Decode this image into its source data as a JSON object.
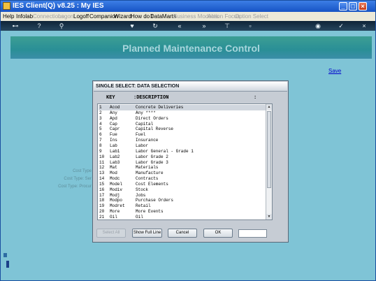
{
  "window": {
    "title": "IES Client(Q) v8.25 : My IES"
  },
  "menu": {
    "items": [
      {
        "label": "Help",
        "enabled": true
      },
      {
        "label": "Infolab",
        "enabled": true
      },
      {
        "label": "Connections",
        "enabled": false
      },
      {
        "label": "Logon",
        "enabled": false
      },
      {
        "label": "Logoff",
        "enabled": true
      },
      {
        "label": "Companion",
        "enabled": true
      },
      {
        "label": "Wizard",
        "enabled": true
      },
      {
        "label": "How do I",
        "enabled": true
      },
      {
        "label": "DataMarts",
        "enabled": true
      },
      {
        "label": "Business Modules",
        "enabled": false
      },
      {
        "label": "Action Focus",
        "enabled": false
      },
      {
        "label": "Option Select",
        "enabled": false
      }
    ]
  },
  "toolbar": {
    "icons": [
      "key-icon",
      "help-icon",
      "search-icon",
      "heart-icon",
      "refresh-icon",
      "rewind-icon",
      "forward-icon",
      "filter-icon",
      "stop-icon",
      "globe-icon",
      "check-icon",
      "close-icon"
    ]
  },
  "page": {
    "title": "Planned Maintenance Control",
    "save_link": "Save",
    "bg_labels": [
      "Cost Type",
      "Cost Type: Ser",
      "Cost Type: Procur"
    ]
  },
  "dialog": {
    "title": "SINGLE SELECT: DATA SELECTION",
    "header": {
      "key": "KEY",
      "description": ":DESCRIPTION",
      "tail": ":"
    },
    "rows": [
      {
        "num": "1",
        "key": "Acod",
        "desc": "Concrete Deliveries"
      },
      {
        "num": "2",
        "key": "Any",
        "desc": "Any ****"
      },
      {
        "num": "3",
        "key": "Apd",
        "desc": "Direct Orders"
      },
      {
        "num": "4",
        "key": "Cap",
        "desc": "Capital"
      },
      {
        "num": "5",
        "key": "Capr",
        "desc": "Capital Reverse"
      },
      {
        "num": "6",
        "key": "Fue",
        "desc": "Fuel"
      },
      {
        "num": "7",
        "key": "Ins",
        "desc": "Insurance"
      },
      {
        "num": "8",
        "key": "Lab",
        "desc": "Labor"
      },
      {
        "num": "9",
        "key": "Lab1",
        "desc": "Labor General - Grade 1"
      },
      {
        "num": "10",
        "key": "Lab2",
        "desc": "Labor Grade 2"
      },
      {
        "num": "11",
        "key": "Lab3",
        "desc": "Labor Grade 3"
      },
      {
        "num": "12",
        "key": "Mat",
        "desc": "Materials"
      },
      {
        "num": "13",
        "key": "Mod",
        "desc": "Manufacture"
      },
      {
        "num": "14",
        "key": "Modc",
        "desc": "Contracts"
      },
      {
        "num": "15",
        "key": "Model",
        "desc": "Cost Elements"
      },
      {
        "num": "16",
        "key": "Modiv",
        "desc": "Stock"
      },
      {
        "num": "17",
        "key": "Modj",
        "desc": "Jobs"
      },
      {
        "num": "18",
        "key": "Modpo",
        "desc": "Purchase Orders"
      },
      {
        "num": "19",
        "key": "Modret",
        "desc": "Retail"
      },
      {
        "num": "20",
        "key": "More",
        "desc": "More Events"
      },
      {
        "num": "21",
        "key": "Oil",
        "desc": "Oil"
      }
    ],
    "buttons": {
      "select_all": "Select All",
      "show_full_line": "Show Full Line",
      "cancel": "Cancel",
      "ok": "OK"
    }
  },
  "colors": {
    "background": "#7fc4d6",
    "banner": "#2a8f96",
    "titlebar": "#1653c4"
  }
}
